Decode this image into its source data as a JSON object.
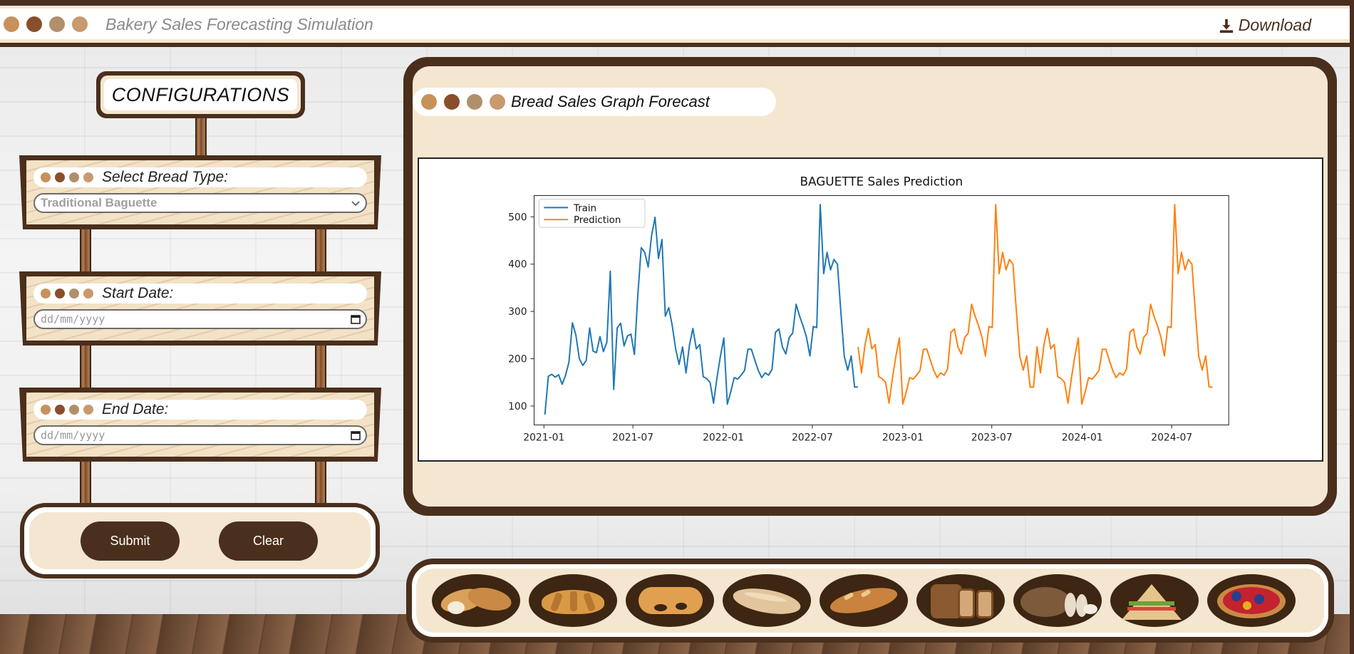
{
  "app": {
    "title": "Bakery Sales Forecasting Simulation",
    "download_label": "Download",
    "window_dots": [
      "#c8905a",
      "#8a4e2c",
      "#b0906c",
      "#c89a6e"
    ]
  },
  "config": {
    "title": "CONFIGURATIONS",
    "bread_type": {
      "label": "Select Bread Type:",
      "value": "Traditional Baguette"
    },
    "start_date": {
      "label": "Start Date:",
      "placeholder": "dd/mm/yyyy"
    },
    "end_date": {
      "label": "End Date:",
      "placeholder": "dd/mm/yyyy"
    },
    "submit_label": "Submit",
    "clear_label": "Clear"
  },
  "graph": {
    "header": "Bread Sales Graph Forecast"
  },
  "chart_data": {
    "type": "line",
    "title": "BAGUETTE Sales Prediction",
    "xlabel": "",
    "ylabel": "",
    "x_ticks": [
      "2021-01",
      "2021-07",
      "2022-01",
      "2022-07",
      "2023-01",
      "2023-07",
      "2024-01",
      "2024-07"
    ],
    "y_ticks": [
      100,
      200,
      300,
      400,
      500
    ],
    "ylim": [
      60,
      545
    ],
    "legend_position": "top-left",
    "series": [
      {
        "name": "Train",
        "color": "#1f77b4",
        "x_start": "2021-01-03",
        "freq": "weekly",
        "values": [
          82,
          163,
          167,
          161,
          166,
          146,
          165,
          193,
          276,
          250,
          200,
          186,
          196,
          265,
          216,
          213,
          247,
          215,
          235,
          385,
          135,
          265,
          275,
          227,
          248,
          252,
          209,
          334,
          435,
          425,
          394,
          460,
          499,
          412,
          452,
          290,
          308,
          270,
          220,
          188,
          225,
          170,
          229,
          264,
          221,
          230,
          162,
          158,
          150,
          106,
          160,
          205,
          244,
          104,
          130,
          160,
          157,
          165,
          175,
          220,
          220,
          197,
          175,
          160,
          170,
          165,
          178,
          256,
          263,
          225,
          210,
          245,
          254,
          315,
          290,
          270,
          246,
          206,
          268,
          266,
          526,
          380,
          425,
          388,
          410,
          400,
          300,
          205,
          176,
          206,
          140,
          140
        ]
      },
      {
        "name": "Prediction",
        "color": "#ff7f0e",
        "x_start": "2022-10-02",
        "freq": "weekly",
        "values": [
          225,
          170,
          229,
          264,
          221,
          230,
          162,
          158,
          150,
          106,
          160,
          205,
          244,
          104,
          130,
          160,
          157,
          165,
          175,
          220,
          220,
          197,
          175,
          160,
          170,
          165,
          178,
          256,
          263,
          225,
          210,
          245,
          254,
          315,
          290,
          270,
          246,
          206,
          268,
          266,
          526,
          380,
          425,
          388,
          410,
          400,
          300,
          205,
          176,
          206,
          140,
          140,
          225,
          170,
          229,
          264,
          221,
          230,
          162,
          158,
          150,
          106,
          160,
          205,
          244,
          104,
          130,
          160,
          157,
          165,
          175,
          220,
          220,
          197,
          175,
          160,
          170,
          165,
          178,
          256,
          263,
          225,
          210,
          245,
          254,
          315,
          290,
          270,
          246,
          206,
          268,
          266,
          526,
          380,
          425,
          388,
          410,
          400,
          300,
          205,
          176,
          206,
          140,
          140
        ]
      }
    ]
  },
  "breads": [
    {
      "name": "baguette-halves-icon"
    },
    {
      "name": "croissant-icon"
    },
    {
      "name": "pain-au-chocolat-icon"
    },
    {
      "name": "white-loaf-icon"
    },
    {
      "name": "french-loaf-icon"
    },
    {
      "name": "sliced-grain-bread-icon"
    },
    {
      "name": "rye-bread-icon"
    },
    {
      "name": "sandwich-icon"
    },
    {
      "name": "fruit-tart-icon"
    }
  ]
}
